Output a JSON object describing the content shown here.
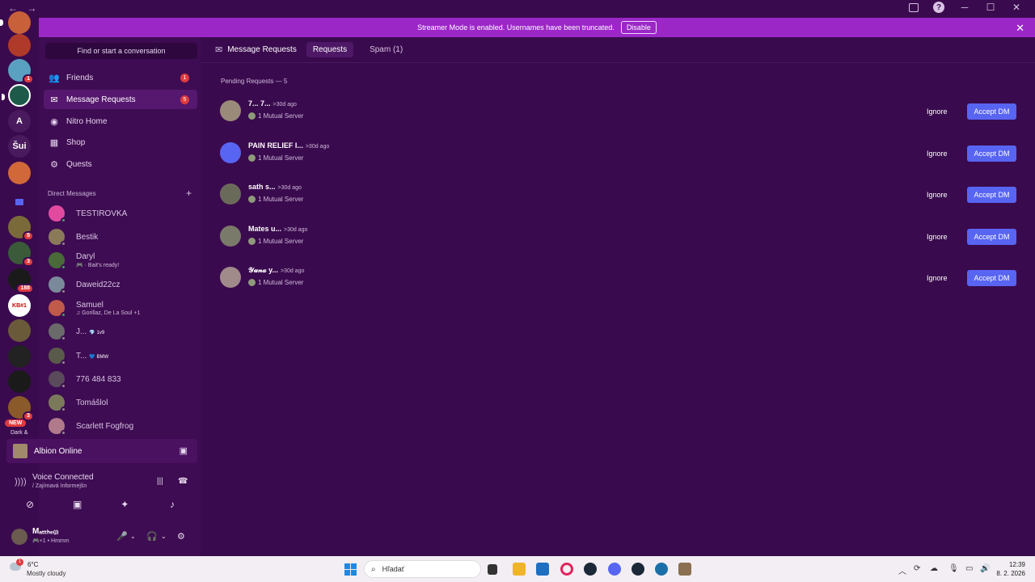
{
  "titlebar": {
    "back": "←",
    "forward": "→"
  },
  "banner": {
    "text": "Streamer Mode is enabled. Usernames have been truncated.",
    "disable_label": "Disable",
    "close": "✕"
  },
  "rail": {
    "letter_a": "A",
    "sui": "Šui",
    "badges": {
      "b1": "1",
      "b2": "5",
      "b3": "3",
      "b4": "188",
      "b5": "3"
    },
    "kb": "KB#1",
    "new_label": "NEW",
    "dark_label": "Dark &"
  },
  "sidebar": {
    "search_placeholder": "Find or start a conversation",
    "nav": [
      {
        "label": "Friends",
        "icon": "friends-icon",
        "count": "1"
      },
      {
        "label": "Message Requests",
        "icon": "envelope-icon",
        "count": "5"
      },
      {
        "label": "Nitro Home",
        "icon": "nitro-icon"
      },
      {
        "label": "Shop",
        "icon": "shop-icon"
      },
      {
        "label": "Quests",
        "icon": "quests-icon"
      }
    ],
    "dm_header": "Direct Messages",
    "dm_plus": "+",
    "dms": [
      {
        "name": "TESTIROVKA"
      },
      {
        "name": "Bestik"
      },
      {
        "name": "Daryl",
        "sub": "🎮 · Bait's ready!"
      },
      {
        "name": "Daweid22cz"
      },
      {
        "name": "Samuel",
        "sub": "♫ Gorillaz, De La Soul +1"
      },
      {
        "name": "J...",
        "tag": "💎 1v9"
      },
      {
        "name": "T...",
        "tag": "💙 BMW"
      },
      {
        "name": "776 484 833"
      },
      {
        "name": "Tomášlol"
      },
      {
        "name": "Scarlett Fogfrog"
      }
    ],
    "game": "Albion Online",
    "voice": {
      "title": "Voice Connected",
      "sub": "/ Zajímavá Informejšn"
    },
    "user": {
      "name": "Mₐₜₜₕₑ₍ⱼ₎",
      "status": "🎮+1 • Hmmm"
    }
  },
  "main": {
    "tab_title": "Message Requests",
    "tabs": [
      "Requests",
      "Spam (1)"
    ],
    "pending": "Pending Requests — 5",
    "requests": [
      {
        "name": "7... 7...",
        "ago": ">30d ago",
        "mutual": "1 Mutual Server"
      },
      {
        "name": "PAIN RELIEF I...",
        "ago": ">30d ago",
        "mutual": "1 Mutual Server"
      },
      {
        "name": "sath s...",
        "ago": ">30d ago",
        "mutual": "1 Mutual Server"
      },
      {
        "name": "Mates u...",
        "ago": ">30d ago",
        "mutual": "1 Mutual Server"
      },
      {
        "name": "𝒴𝓊𝓃𝒶 y...",
        "ago": ">30d ago",
        "mutual": "1 Mutual Server"
      }
    ],
    "ignore_label": "Ignore",
    "accept_label": "Accept DM"
  },
  "taskbar": {
    "temp": "6°C",
    "weather": "Mostly cloudy",
    "weather_badge": "1",
    "search": "Hľadať",
    "time": "12:39",
    "date": "8. 2. 2026"
  },
  "colors": {
    "accent": "#5865f2",
    "banner": "#9b27c7",
    "bg": "#3a0a4e",
    "badge": "#e03a3e"
  }
}
